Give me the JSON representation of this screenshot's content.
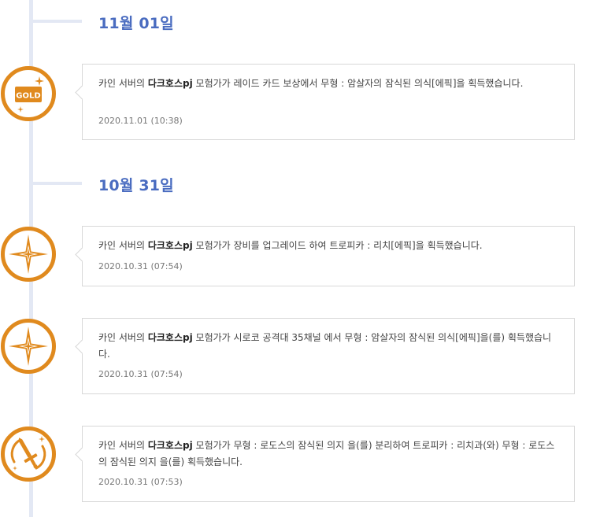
{
  "colors": {
    "accent_orange": "#e08a1e",
    "date_blue": "#4a6cc0",
    "timeline": "#e3e8f4"
  },
  "dates": [
    {
      "label": "11월 01일"
    },
    {
      "label": "10월 31일"
    }
  ],
  "entries": [
    {
      "icon": "gold-icon",
      "icon_label": "GOLD",
      "prefix": "카인 서버의 ",
      "character": "다크호스pj",
      "message": " 모험가가 레이드 카드 보상에서 무형 : 암살자의 잠식된 의식[에픽]을 획득했습니다.",
      "timestamp": "2020.11.01 (10:38)"
    },
    {
      "icon": "sparkle-star-icon",
      "prefix": "카인 서버의 ",
      "character": "다크호스pj",
      "message": " 모험가가 장비를 업그레이드 하여 트로피카 : 리치[에픽]을 획득했습니다.",
      "timestamp": "2020.10.31 (07:54)"
    },
    {
      "icon": "sparkle-star-icon",
      "prefix": "카인 서버의 ",
      "character": "다크호스pj",
      "message": " 모험가가 시로코 공격대 35채널 에서 무형 : 암살자의 잠식된 의식[에픽]을(를) 획득했습니다.",
      "timestamp": "2020.10.31 (07:54)"
    },
    {
      "icon": "sword-icon",
      "prefix": "카인 서버의 ",
      "character": "다크호스pj",
      "message": " 모험가가 무형 : 로도스의 잠식된 의지 을(를) 분리하여 트로피카 : 리치과(와) 무형 : 로도스의 잠식된 의지 을(를) 획득했습니다.",
      "timestamp": "2020.10.31 (07:53)"
    }
  ]
}
